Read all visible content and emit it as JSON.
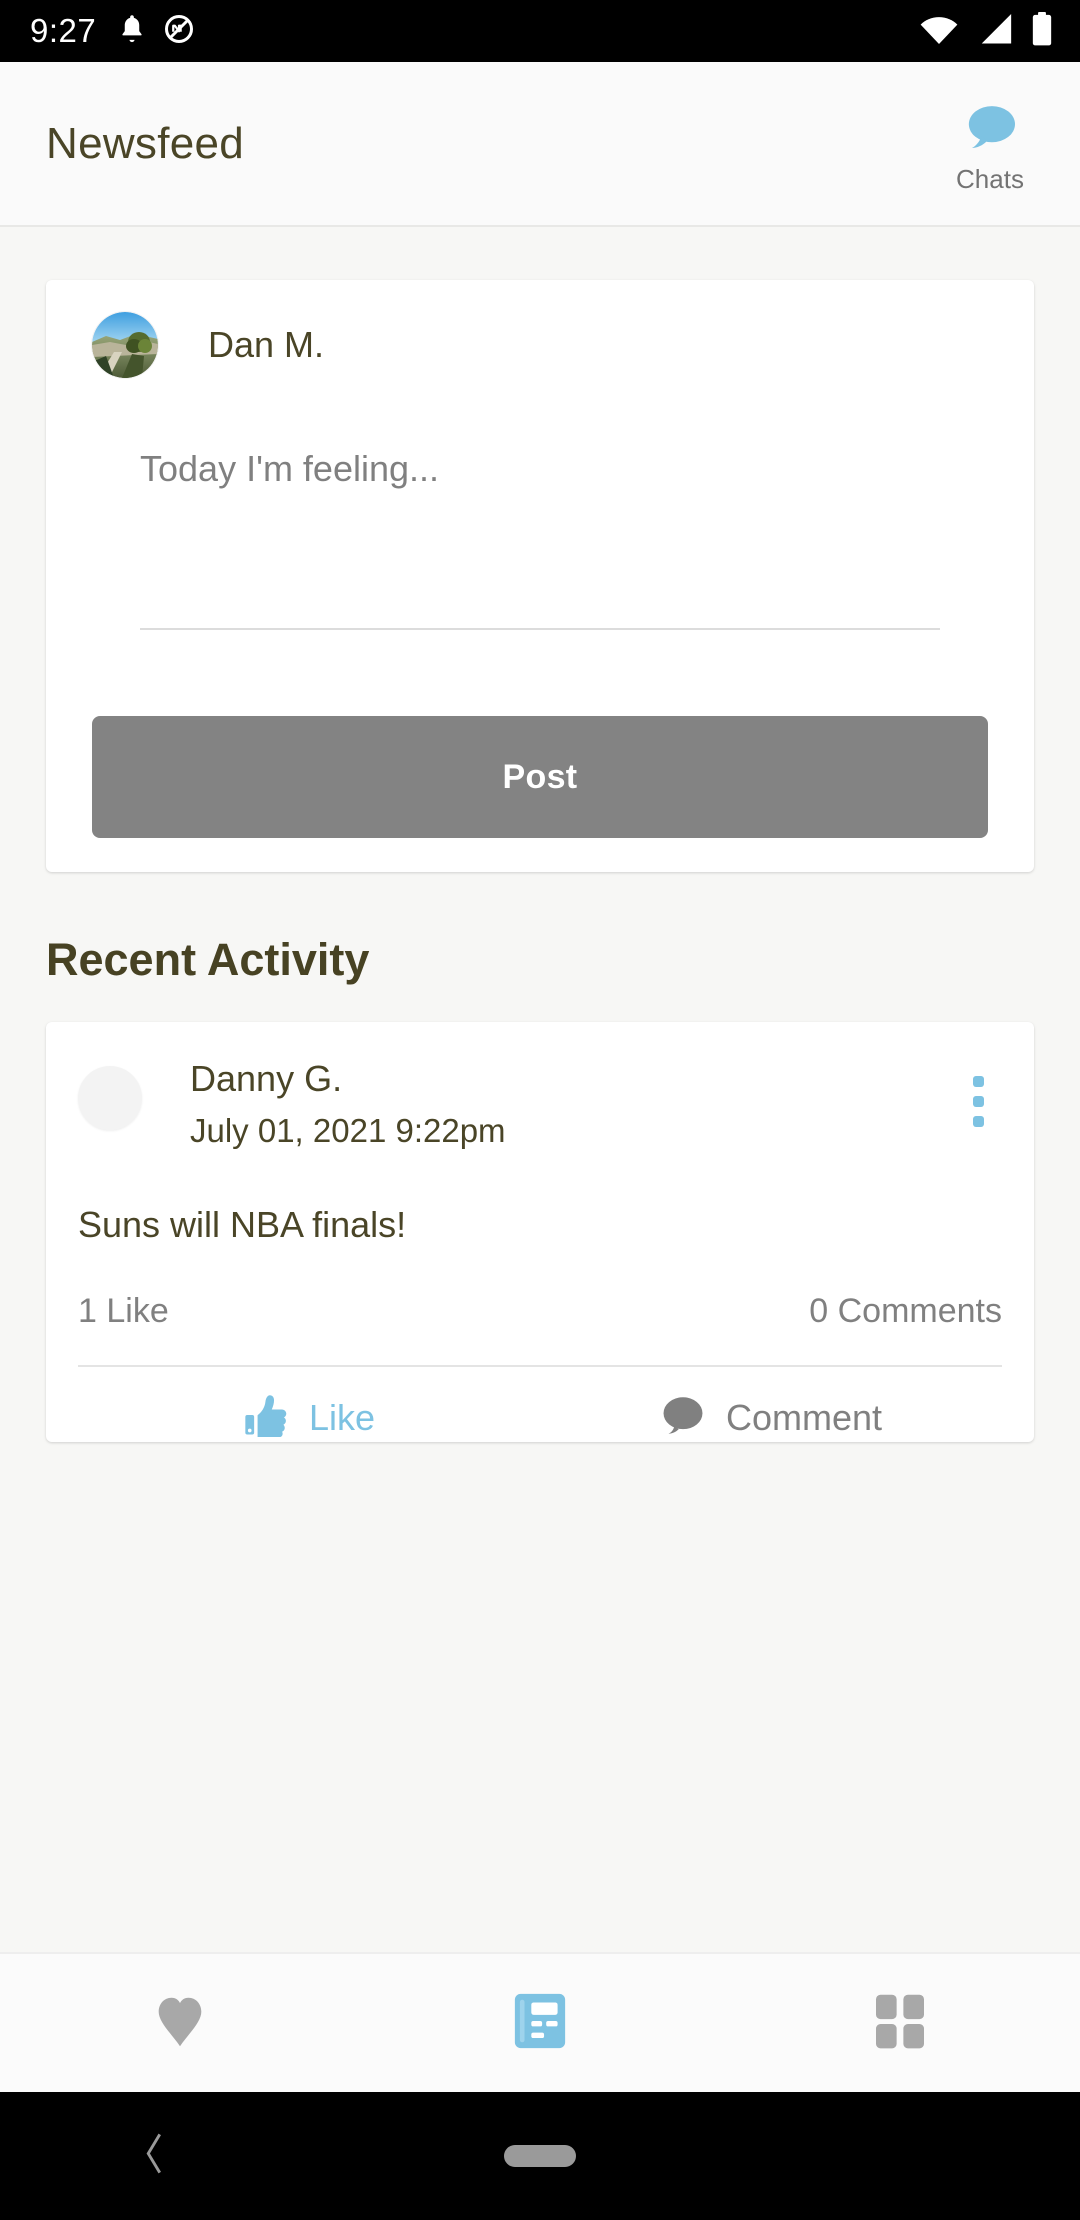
{
  "status_bar": {
    "time": "9:27",
    "left_icons": [
      "notification-bell-icon",
      "do-not-disturb-icon"
    ],
    "right_icons": [
      "wifi-icon",
      "cell-signal-icon",
      "battery-icon"
    ],
    "background_color": "#000000",
    "icon_color": "#ffffff"
  },
  "app_bar": {
    "title": "Newsfeed",
    "title_color": "#4a4527",
    "chats": {
      "label": "Chats",
      "icon": "chat-bubble-icon",
      "icon_color": "#7dc2e2",
      "label_color": "#737373"
    }
  },
  "composer": {
    "author_name": "Dan M.",
    "avatar": "landscape-photo-avatar",
    "input_placeholder": "Today I'm feeling...",
    "input_value": "",
    "post_button_label": "Post",
    "post_button_color": "#838383",
    "post_button_text_color": "#ffffff"
  },
  "section": {
    "recent_activity_title": "Recent Activity",
    "title_color": "#474223"
  },
  "activity_post": {
    "author_name": "Danny G.",
    "timestamp": "July 01, 2021 9:22pm",
    "body": "Suns will NBA finals!",
    "likes_text": "1 Like",
    "comments_text": "0 Comments",
    "menu_icon": "three-dot-vertical-menu-icon",
    "menu_icon_color": "#7dc2e2",
    "actions": {
      "like": {
        "label": "Like",
        "icon": "thumbs-up-icon",
        "color": "#7dc2e2"
      },
      "comment": {
        "label": "Comment",
        "icon": "speech-bubble-icon",
        "color": "#808080"
      }
    }
  },
  "tab_bar": {
    "tabs": [
      {
        "name": "favorites",
        "icon": "heart-icon",
        "active": false,
        "color": "#a8a8a8"
      },
      {
        "name": "newsfeed",
        "icon": "newsfeed-article-icon",
        "active": true,
        "color": "#7dc2e2"
      },
      {
        "name": "more",
        "icon": "grid-squares-icon",
        "active": false,
        "color": "#a8a8a8"
      }
    ]
  },
  "android_nav": {
    "back_icon": "back-chevron-icon",
    "home_icon": "home-pill-indicator",
    "background_color": "#000000"
  }
}
